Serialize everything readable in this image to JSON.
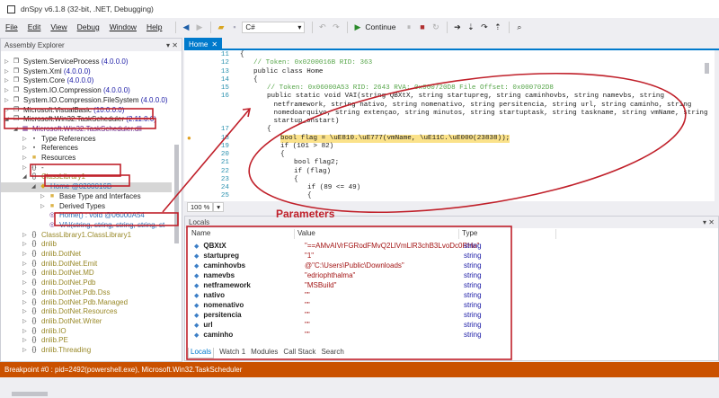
{
  "window": {
    "title": "dnSpy v6.1.8 (32-bit, .NET, Debugging)"
  },
  "menu": [
    "File",
    "Edit",
    "View",
    "Debug",
    "Window",
    "Help"
  ],
  "toolbar": {
    "language": "C#",
    "continue_label": "Continue"
  },
  "assembly_explorer": {
    "title": "Assembly Explorer",
    "items": [
      {
        "level": 0,
        "exp": "▷",
        "icon": "assembly-icon",
        "label": "System.ServiceProcess",
        "ver": "(4.0.0.0)"
      },
      {
        "level": 0,
        "exp": "▷",
        "icon": "assembly-icon",
        "label": "System.Xml",
        "ver": "(4.0.0.0)"
      },
      {
        "level": 0,
        "exp": "▷",
        "icon": "assembly-icon",
        "label": "System.Core",
        "ver": "(4.0.0.0)"
      },
      {
        "level": 0,
        "exp": "▷",
        "icon": "assembly-icon",
        "label": "System.IO.Compression",
        "ver": "(4.0.0.0)"
      },
      {
        "level": 0,
        "exp": "▷",
        "icon": "assembly-icon",
        "label": "System.IO.Compression.FileSystem",
        "ver": "(4.0.0.0)"
      },
      {
        "level": 0,
        "exp": "▷",
        "icon": "assembly-icon",
        "label": "Microsoft.VisualBasic",
        "ver": "(10.0.0.0)"
      },
      {
        "level": 0,
        "exp": "◢",
        "icon": "assembly-icon",
        "label": "Microsoft.Win32.TaskScheduler",
        "ver": "(2.11.0.0)"
      },
      {
        "level": 1,
        "exp": "◢",
        "icon": "module-icon",
        "label": "Microsoft.Win32.TaskScheduler.dll",
        "ver": "",
        "color": "#6b2a8a"
      },
      {
        "level": 2,
        "exp": "▷",
        "icon": "references-icon",
        "label": "Type References",
        "ver": ""
      },
      {
        "level": 2,
        "exp": "▷",
        "icon": "references-icon",
        "label": "References",
        "ver": ""
      },
      {
        "level": 2,
        "exp": "▷",
        "icon": "folder-icon",
        "label": "Resources",
        "ver": ""
      },
      {
        "level": 2,
        "exp": "▷",
        "icon": "namespace-icon",
        "label": "-",
        "ver": ""
      },
      {
        "level": 2,
        "exp": "◢",
        "icon": "namespace-icon",
        "label": "ClassLibrary1",
        "ver": "",
        "color": "#9a8a2a"
      },
      {
        "level": 3,
        "exp": "◢",
        "icon": "class-icon",
        "label": "Home",
        "ver": "@0200016B",
        "color": "#2b6fb5",
        "selected": true
      },
      {
        "level": 4,
        "exp": "▷",
        "icon": "folder-icon",
        "label": "Base Type and Interfaces",
        "ver": ""
      },
      {
        "level": 4,
        "exp": "▷",
        "icon": "folder-icon",
        "label": "Derived Types",
        "ver": ""
      },
      {
        "level": 4,
        "exp": "",
        "icon": "method-icon",
        "label": "Home() : void",
        "ver": "@06000A54",
        "color": "#2b6fb5"
      },
      {
        "level": 4,
        "exp": "",
        "icon": "method-icon",
        "label": "VAI(string, string, string, string, st",
        "ver": "",
        "color": "#2b6fb5"
      },
      {
        "level": 2,
        "exp": "▷",
        "icon": "namespace-icon",
        "label": "ClassLibrary1.ClassLibrary1",
        "ver": "",
        "color": "#9a8a2a"
      },
      {
        "level": 2,
        "exp": "▷",
        "icon": "namespace-icon",
        "label": "dnlib",
        "ver": "",
        "color": "#9a8a2a"
      },
      {
        "level": 2,
        "exp": "▷",
        "icon": "namespace-icon",
        "label": "dnlib.DotNet",
        "ver": "",
        "color": "#9a8a2a"
      },
      {
        "level": 2,
        "exp": "▷",
        "icon": "namespace-icon",
        "label": "dnlib.DotNet.Emit",
        "ver": "",
        "color": "#9a8a2a"
      },
      {
        "level": 2,
        "exp": "▷",
        "icon": "namespace-icon",
        "label": "dnlib.DotNet.MD",
        "ver": "",
        "color": "#9a8a2a"
      },
      {
        "level": 2,
        "exp": "▷",
        "icon": "namespace-icon",
        "label": "dnlib.DotNet.Pdb",
        "ver": "",
        "color": "#9a8a2a"
      },
      {
        "level": 2,
        "exp": "▷",
        "icon": "namespace-icon",
        "label": "dnlib.DotNet.Pdb.Dss",
        "ver": "",
        "color": "#9a8a2a"
      },
      {
        "level": 2,
        "exp": "▷",
        "icon": "namespace-icon",
        "label": "dnlib.DotNet.Pdb.Managed",
        "ver": "",
        "color": "#9a8a2a"
      },
      {
        "level": 2,
        "exp": "▷",
        "icon": "namespace-icon",
        "label": "dnlib.DotNet.Resources",
        "ver": "",
        "color": "#9a8a2a"
      },
      {
        "level": 2,
        "exp": "▷",
        "icon": "namespace-icon",
        "label": "dnlib.DotNet.Writer",
        "ver": "",
        "color": "#9a8a2a"
      },
      {
        "level": 2,
        "exp": "▷",
        "icon": "namespace-icon",
        "label": "dnlib.IO",
        "ver": "",
        "color": "#9a8a2a"
      },
      {
        "level": 2,
        "exp": "▷",
        "icon": "namespace-icon",
        "label": "dnlib.PE",
        "ver": "",
        "color": "#9a8a2a"
      },
      {
        "level": 2,
        "exp": "▷",
        "icon": "namespace-icon",
        "label": "dnlib.Threading",
        "ver": "",
        "color": "#9a8a2a"
      }
    ]
  },
  "editor": {
    "tab": "Home",
    "lines": [
      {
        "n": "11",
        "ind": 0,
        "text": "{",
        "cls": ""
      },
      {
        "n": "12",
        "ind": 1,
        "text": "// Token: 0x0200016B RID: 363",
        "cls": "cm"
      },
      {
        "n": "13",
        "ind": 1,
        "text": "public class Home",
        "cls": ""
      },
      {
        "n": "14",
        "ind": 1,
        "text": "{",
        "cls": ""
      },
      {
        "n": "15",
        "ind": 2,
        "text": "// Token: 0x06000A53 RID: 2643 RVA: 0x000720D8 File Offset: 0x000702D8",
        "cls": "cm"
      },
      {
        "n": "16",
        "ind": 2,
        "text": "public static void VAI(string QBXtX, string startupreg, string caminhovbs, string namevbs, string",
        "cls": ""
      },
      {
        "n": "",
        "ind": 2.5,
        "text": "netframework, string nativo, string nomenativo, string persitencia, string url, string caminho, string",
        "cls": ""
      },
      {
        "n": "",
        "ind": 2.5,
        "text": "nomedoarquivo, string extençao, string minutos, string startuptask, string taskname, string vmName, string",
        "cls": ""
      },
      {
        "n": "",
        "ind": 2.5,
        "text": "startup_onstart)",
        "cls": ""
      },
      {
        "n": "17",
        "ind": 2,
        "text": "{",
        "cls": ""
      },
      {
        "n": "18",
        "ind": 3,
        "text": "bool flag = \\uE810.\\uE777(vmName, \\uE11C.\\uE000(23838));",
        "cls": "hl"
      },
      {
        "n": "19",
        "ind": 3,
        "text": "if (101 > 82)",
        "cls": ""
      },
      {
        "n": "20",
        "ind": 3,
        "text": "{",
        "cls": ""
      },
      {
        "n": "21",
        "ind": 4,
        "text": "bool flag2;",
        "cls": ""
      },
      {
        "n": "22",
        "ind": 4,
        "text": "if (flag)",
        "cls": ""
      },
      {
        "n": "23",
        "ind": 4,
        "text": "{",
        "cls": ""
      },
      {
        "n": "24",
        "ind": 5,
        "text": "if (89 <= 49)",
        "cls": ""
      },
      {
        "n": "25",
        "ind": 5,
        "text": "{",
        "cls": ""
      }
    ],
    "zoom": "100 %"
  },
  "locals": {
    "title": "Locals",
    "columns": [
      "Name",
      "Value",
      "Type"
    ],
    "rows": [
      {
        "name": "QBXtX",
        "value": "\"==AMvAIVrFGRodFMvQ2LlVmLlR3chB3LvoDc0RHa\"",
        "type": "string"
      },
      {
        "name": "startupreg",
        "value": "\"1\"",
        "type": "string"
      },
      {
        "name": "caminhovbs",
        "value": "@\"C:\\Users\\Public\\Downloads\"",
        "type": "string"
      },
      {
        "name": "namevbs",
        "value": "\"edriophthalma\"",
        "type": "string"
      },
      {
        "name": "netframework",
        "value": "\"MSBuild\"",
        "type": "string"
      },
      {
        "name": "nativo",
        "value": "\"\"",
        "type": "string"
      },
      {
        "name": "nomenativo",
        "value": "\"\"",
        "type": "string"
      },
      {
        "name": "persitencia",
        "value": "\"\"",
        "type": "string"
      },
      {
        "name": "url",
        "value": "\"\"",
        "type": "string"
      },
      {
        "name": "caminho",
        "value": "\"\"",
        "type": "string"
      }
    ],
    "tabs": [
      "Locals",
      "Watch 1",
      "Modules",
      "Call Stack",
      "Search"
    ]
  },
  "annotation": {
    "label": "Parameters",
    "color": "#c0202a"
  },
  "status": "Breakpoint #0 : pid=2492(powershell.exe), Microsoft.Win32.TaskScheduler"
}
